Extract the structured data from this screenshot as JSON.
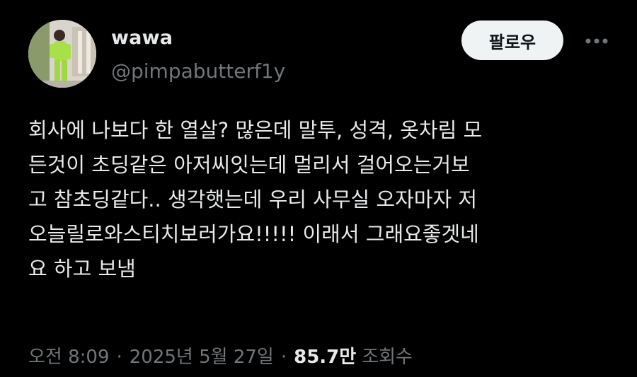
{
  "author": {
    "display_name": "wawa",
    "handle": "@pimpabutterf1y",
    "avatar": "avatar-photo"
  },
  "actions": {
    "follow_label": "팔로우",
    "more_icon": "more-dots-icon"
  },
  "tweet": {
    "text": "회사에 나보다 한 열살? 많은데 말투, 성격, 옷차림 모\n든것이 초딩같은 아저씨잇는데 멀리서 걸어오는거보\n고 참초딩같다.. 생각햇는데 우리 사무실 오자마자 저\n오늘릴로와스티치보러가요!!!!! 이래서 그래요좋겟네\n요 하고 보냄"
  },
  "meta": {
    "time": "오전 8:09",
    "separator": "·",
    "date": "2025년 5월 27일",
    "views_count": "85.7만",
    "views_label": "조회수"
  },
  "colors": {
    "background": "#000000",
    "text": "#e7e9ea",
    "secondary": "#71767b",
    "button_bg": "#eff3f4",
    "button_text": "#0f1419"
  }
}
